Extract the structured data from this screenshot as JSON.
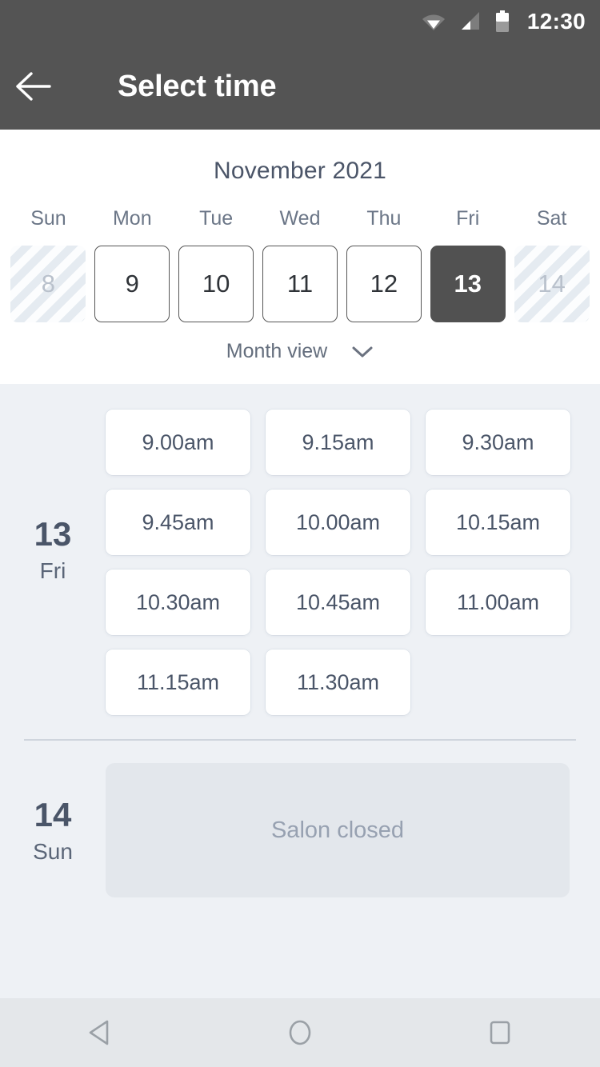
{
  "status_bar": {
    "time": "12:30",
    "icons": [
      "wifi-icon",
      "cellular-signal-icon",
      "battery-icon"
    ]
  },
  "app_bar": {
    "back_icon": "arrow-left-icon",
    "title": "Select time"
  },
  "calendar": {
    "month_title": "November 2021",
    "weekdays": [
      "Sun",
      "Mon",
      "Tue",
      "Wed",
      "Thu",
      "Fri",
      "Sat"
    ],
    "days": [
      {
        "num": "8",
        "state": "disabled"
      },
      {
        "num": "9",
        "state": "enabled"
      },
      {
        "num": "10",
        "state": "enabled"
      },
      {
        "num": "11",
        "state": "enabled"
      },
      {
        "num": "12",
        "state": "enabled"
      },
      {
        "num": "13",
        "state": "selected"
      },
      {
        "num": "14",
        "state": "disabled"
      }
    ],
    "view_toggle": {
      "label": "Month view",
      "icon": "chevron-down-icon"
    }
  },
  "schedule": {
    "groups": [
      {
        "day_number": "13",
        "day_of_week": "Fri",
        "slots": [
          "9.00am",
          "9.15am",
          "9.30am",
          "9.45am",
          "10.00am",
          "10.15am",
          "10.30am",
          "10.45am",
          "11.00am",
          "11.15am",
          "11.30am"
        ]
      },
      {
        "day_number": "14",
        "day_of_week": "Sun",
        "closed_message": "Salon closed"
      }
    ]
  },
  "nav_bar": {
    "back": "nav-back-icon",
    "home": "nav-home-icon",
    "recents": "nav-recents-icon"
  },
  "colors": {
    "app_bar": "#545454",
    "selected_day": "#515151",
    "panel_bg": "#eef1f5",
    "slot_text": "#4a5568",
    "closed_card": "#e3e7ec"
  }
}
